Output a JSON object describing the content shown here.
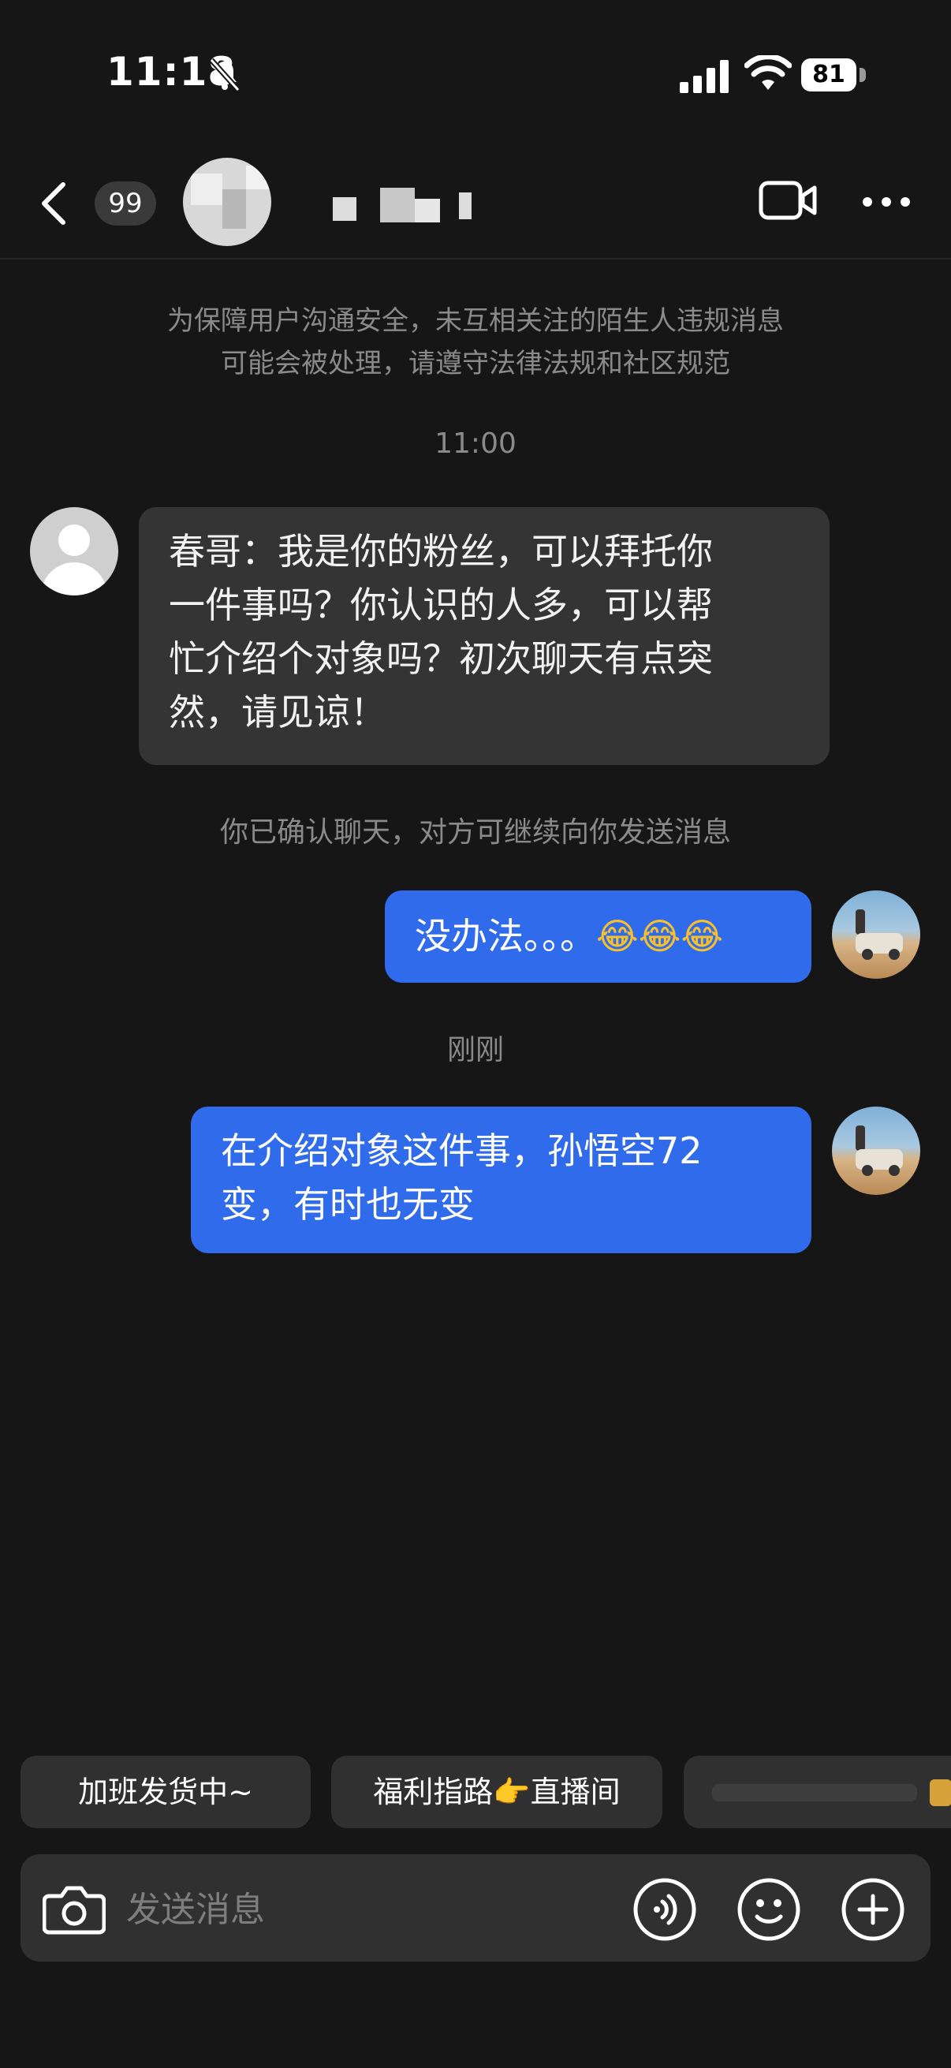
{
  "status_bar": {
    "time": "11:18",
    "battery": "81"
  },
  "nav": {
    "unread_count": "99"
  },
  "notices": {
    "safety": [
      "为保障用户沟通安全，未互相关注的陌生人违规消息",
      "可能会被处理，请遵守法律法规和社区规范"
    ],
    "time_first": "11:00",
    "confirmed": "你已确认聊天，对方可继续向你发送消息",
    "time_second": "刚刚"
  },
  "messages": [
    {
      "direction": "received",
      "lines": [
        "春哥：我是你的粉丝，可以拜托你",
        "一件事吗？你认识的人多，可以帮",
        "忙介绍个对象吗？初次聊天有点突",
        "然，请见谅！"
      ]
    },
    {
      "direction": "sent",
      "text": "没办法。。。",
      "emoji": "😂😂😂"
    },
    {
      "direction": "sent",
      "lines": [
        "在介绍对象这件事，孙悟空72",
        "变，有时也无变"
      ]
    }
  ],
  "quick_replies": [
    {
      "label": "加班发货中~"
    },
    {
      "label_before": "福利指路",
      "emoji": "👉",
      "label_after": "直播间"
    }
  ],
  "input": {
    "placeholder": "发送消息"
  },
  "icons": {
    "back": "chevron-left-icon",
    "video": "video-camera-icon",
    "more": "ellipsis-icon",
    "camera": "camera-icon",
    "voice": "voice-icon",
    "emoji": "smiley-icon",
    "plus": "plus-icon"
  },
  "colors": {
    "background": "#161616",
    "received_bubble": "#343434",
    "sent_bubble": "#2f6bea",
    "notice_text": "#8a8a8a",
    "input_bar": "#303030"
  }
}
